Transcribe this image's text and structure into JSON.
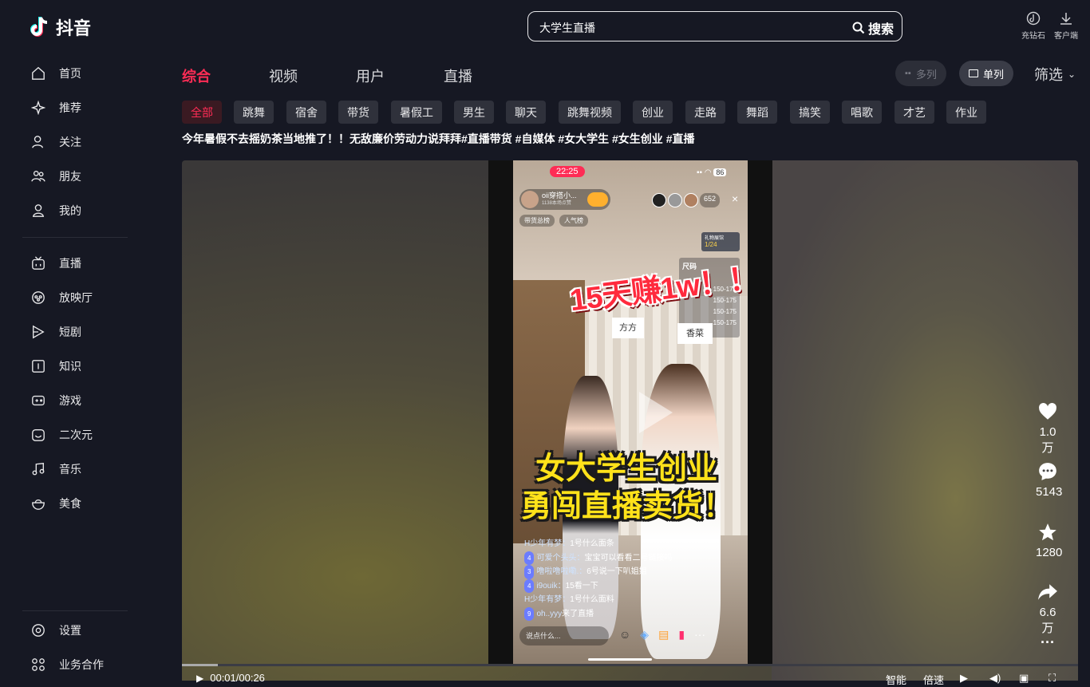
{
  "logo": {
    "text": "抖音"
  },
  "sidebar": {
    "items": [
      {
        "label": "首页",
        "icon": "home-icon"
      },
      {
        "label": "推荐",
        "icon": "sparkle-icon"
      },
      {
        "label": "关注",
        "icon": "follow-icon"
      },
      {
        "label": "朋友",
        "icon": "friends-icon"
      },
      {
        "label": "我的",
        "icon": "user-icon"
      },
      {
        "label": "直播",
        "icon": "tv-icon"
      },
      {
        "label": "放映厅",
        "icon": "cinema-icon"
      },
      {
        "label": "短剧",
        "icon": "play-icon"
      },
      {
        "label": "知识",
        "icon": "knowledge-icon"
      },
      {
        "label": "游戏",
        "icon": "gamepad-icon"
      },
      {
        "label": "二次元",
        "icon": "anime-icon"
      },
      {
        "label": "音乐",
        "icon": "music-icon"
      },
      {
        "label": "美食",
        "icon": "food-icon"
      }
    ],
    "bottom": [
      {
        "label": "设置",
        "icon": "settings-icon"
      },
      {
        "label": "业务合作",
        "icon": "grid-icon"
      }
    ]
  },
  "search": {
    "value": "大学生直播",
    "button": "搜索"
  },
  "top_tools": [
    {
      "label": "充钻石",
      "icon": "diamond-icon"
    },
    {
      "label": "客户端",
      "icon": "download-icon"
    }
  ],
  "tabs": [
    "综合",
    "视频",
    "用户",
    "直播"
  ],
  "view": {
    "multi": "多列",
    "single": "单列",
    "filter": "筛选"
  },
  "chips": [
    "全部",
    "跳舞",
    "宿舍",
    "带货",
    "暑假工",
    "男生",
    "聊天",
    "跳舞视频",
    "创业",
    "走路",
    "舞蹈",
    "搞笑",
    "唱歌",
    "才艺",
    "作业"
  ],
  "video": {
    "title": "今年暑假不去摇奶茶当地推了！！无敌廉价劳动力说拜拜#直播带货 #自媒体 #女大学生 #女生创业 #直播",
    "status_time": "22:25",
    "battery": "86",
    "streamer": "oii穿搭小...",
    "streamer_sub": "1138本场点赞",
    "viewer_count": "652",
    "tag1": "带货总榜",
    "tag2": "人气榜",
    "gift_label": "礼物展馆",
    "gift_count": "1/24",
    "size_label": "尺码",
    "sizes": [
      "150-175",
      "150-175",
      "150-175",
      "150-175"
    ],
    "overlay_red": "15天赚1w！！",
    "overlay_y1": "女大学生创业",
    "overlay_y2": "勇闯直播卖货！",
    "sign_left": "方方",
    "sign_right": "香菜",
    "comments": [
      {
        "lv": "",
        "name": "H少年有梦：",
        "text": "1号什么面条"
      },
      {
        "lv": "4",
        "name": "可爱个头头：",
        "text": "宝宝可以看看二号链接吗"
      },
      {
        "lv": "3",
        "name": "噜啦噜啦嘞.：",
        "text": "6号说一下叭姐姐"
      },
      {
        "lv": "4",
        "name": "i9ouik：",
        "text": "15看一下"
      },
      {
        "lv": "",
        "name": "H少年有梦：",
        "text": "1号什么面料"
      },
      {
        "lv": "9",
        "name": "oh..yyy",
        "text": "来了直播"
      }
    ],
    "input_placeholder": "说点什么...",
    "time": "00:01/00:26",
    "progress": 0.04
  },
  "actions": [
    {
      "icon": "heart-icon",
      "count": "1.0万"
    },
    {
      "icon": "comment-icon",
      "count": "5143"
    },
    {
      "icon": "star-icon",
      "count": "1280"
    },
    {
      "icon": "share-icon",
      "count": "6.6万"
    }
  ],
  "controls": {
    "smart": "智能",
    "speed": "倍速"
  },
  "colors": {
    "accent": "#fe2c55",
    "bg": "#161823"
  }
}
